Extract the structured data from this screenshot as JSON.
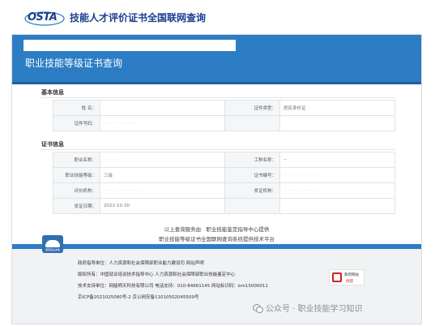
{
  "header": {
    "logo_text": "OSTA",
    "site_title": "技能人才评价证书全国联网查询"
  },
  "banner": {
    "title": "职业技能等级证书查询"
  },
  "basic_info": {
    "section_title": "基本信息",
    "name_label": "姓    名：",
    "name_value": "· ·· ·",
    "cert_type_label": "证件类型：",
    "cert_type_value": "居民身份证",
    "id_label": "证件号码：",
    "id_value": "··················"
  },
  "cert_info": {
    "section_title": "证书信息",
    "occupation_label": "职业名称：",
    "occupation_value": "· ·· ···",
    "job_type_label": "工种名称：",
    "job_type_value": "--",
    "level_label": "职业技能等级：",
    "level_value": "三级",
    "cert_no_label": "证书编号：",
    "cert_no_value": "·····················",
    "org_label": "评价机构：",
    "org_value": "························",
    "issuer_label": "发证机构：",
    "issuer_value": "···················",
    "date_label": "发证日期：",
    "date_value": "2022-10-30"
  },
  "notes": {
    "line1_prefix": "以上查询服务由",
    "line1_blur": "· ·",
    "line1_suffix": "职业技能鉴定指导中心提供",
    "line2": "职业技能等级证书全国联网查询系统提供技术平台"
  },
  "footer": {
    "badge_text": "国家职业资格",
    "line1": "政府指导单位：人力资源和社会保障部职业能力建设司           网站声明",
    "line2": "版权所有：中国就业培训技术指导中心  人力资源和社会保障部职业技能鉴定中心",
    "line3": "技术支持单位：网能明天科技有限公司   电话支持：010-84661145   网站标识码：bm15000011",
    "line4": "京ICP备2021025080号-2    京公网安备11010502045509号",
    "gov_line1": "政府网站",
    "gov_line2": "找错"
  },
  "watermark": {
    "text": "公众号 · 职业技能学习知识"
  },
  "colors": {
    "primary_blue": "#2c7dc4",
    "title_blue": "#1a3d8f",
    "gov_red": "#cc2222"
  }
}
